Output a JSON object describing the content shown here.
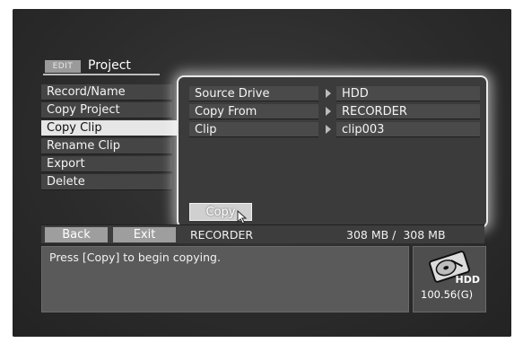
{
  "header": {
    "badge": "EDIT",
    "title": "Project"
  },
  "menu": {
    "items": [
      {
        "label": "Record/Name"
      },
      {
        "label": "Copy Project"
      },
      {
        "label": "Copy Clip"
      },
      {
        "label": "Rename Clip"
      },
      {
        "label": "Export"
      },
      {
        "label": "Delete"
      }
    ],
    "selected": "Copy Clip"
  },
  "panel": {
    "fields": [
      {
        "label": "Source Drive",
        "value": "HDD"
      },
      {
        "label": "Copy From",
        "value": "RECORDER"
      },
      {
        "label": "Clip",
        "value": "clip003"
      }
    ],
    "copy_button": "Copy"
  },
  "status_bar": {
    "back_label": "Back",
    "exit_label": "Exit",
    "source": "RECORDER",
    "size": "308 MB /  308 MB"
  },
  "message": "Press [Copy] to begin copying.",
  "hdd": {
    "icon": "hdd-icon",
    "label": "HDD",
    "free": "100.56(G)"
  }
}
